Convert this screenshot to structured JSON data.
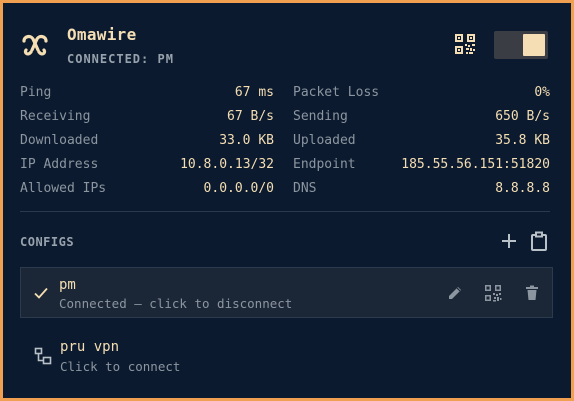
{
  "app": {
    "name": "Omawire",
    "status": "CONNECTED: PM",
    "toggle_on": true
  },
  "stats": [
    {
      "left_label": "Ping",
      "left_value": "67 ms",
      "right_label": "Packet Loss",
      "right_value": "0%"
    },
    {
      "left_label": "Receiving",
      "left_value": "67 B/s",
      "right_label": "Sending",
      "right_value": "650 B/s"
    },
    {
      "left_label": "Downloaded",
      "left_value": "33.0 KB",
      "right_label": "Uploaded",
      "right_value": "35.8 KB"
    },
    {
      "left_label": "IP Address",
      "left_value": "10.8.0.13/32",
      "right_label": "Endpoint",
      "right_value": "185.55.56.151:51820"
    },
    {
      "left_label": "Allowed IPs",
      "left_value": "0.0.0.0/0",
      "right_label": "DNS",
      "right_value": "8.8.8.8"
    }
  ],
  "configs": {
    "title": "CONFIGS",
    "items": [
      {
        "name": "pm",
        "subtitle": "Connected — click to disconnect",
        "active": true
      },
      {
        "name": "pru vpn",
        "subtitle": "Click to connect",
        "active": false
      }
    ]
  },
  "icons": {
    "logo": "link-knot-icon",
    "qr": "qr-code-icon",
    "add": "plus-icon",
    "clipboard": "clipboard-icon",
    "check": "check-icon",
    "edit": "pencil-icon",
    "delete": "trash-icon",
    "network": "network-icon"
  },
  "colors": {
    "accent": "#f5deb3",
    "background": "#0b1a2e",
    "frame": "#f0a050",
    "muted": "#8c96a0"
  }
}
